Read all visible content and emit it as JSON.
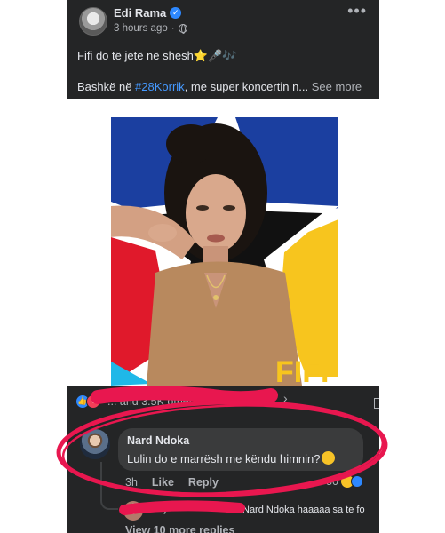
{
  "post": {
    "author": "Edi Rama",
    "verified_mark": "✓",
    "time": "3 hours ago",
    "time_separator": "·",
    "more_label": "•••",
    "line1": "Fifi do të jetë në shesh⭐🎤🎶",
    "line2_prefix": "Bashkë në ",
    "hashtag": "#28Korrik",
    "line2_suffix": ", me super koncertin n...",
    "see_more": "See more"
  },
  "poster": {
    "caption_fragment": "FIFI",
    "colors": {
      "blue": "#1b3fa0",
      "red": "#e0192b",
      "yellow": "#f7c51e",
      "black": "#111111",
      "cyan": "#1fb8e8"
    }
  },
  "reactions": {
    "icons": [
      "like-icon",
      "love-icon"
    ],
    "text_visible": "... and 3.5K others",
    "chevron": "›"
  },
  "comment": {
    "author": "Nard Ndoka",
    "text": "Lulin do e marrësh me këndu himnin?",
    "time": "3h",
    "like_label": "Like",
    "reply_label": "Reply",
    "reaction_count": "80"
  },
  "reply": {
    "author_fragment": "...laj",
    "mention": "Nard Ndoka",
    "text": "haaaaa sa te fo"
  },
  "view_more": "View 10 more replies",
  "annotation": {
    "ellipse_color": "#e8174f"
  }
}
